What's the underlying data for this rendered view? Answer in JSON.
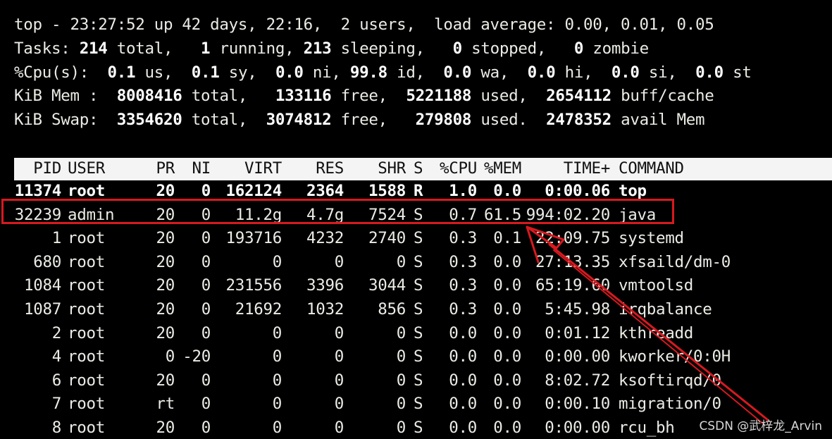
{
  "summary": {
    "line1": "top - 23:27:52 up 42 days, 22:16,  2 users,  load average: 0.00, 0.01, 0.05",
    "tasks": {
      "label": "Tasks:",
      "total": "214",
      "t_total": " total,   ",
      "running": "1",
      "t_running": " running, ",
      "sleeping": "213",
      "t_sleeping": " sleeping,   ",
      "stopped": "0",
      "t_stopped": " stopped,   ",
      "zombie": "0",
      "t_zombie": " zombie"
    },
    "cpu": {
      "label": "%Cpu(s):  ",
      "us": "0.1",
      "t_us": " us,  ",
      "sy": "0.1",
      "t_sy": " sy,  ",
      "ni": "0.0",
      "t_ni": " ni, ",
      "id": "99.8",
      "t_id": " id,  ",
      "wa": "0.0",
      "t_wa": " wa,  ",
      "hi": "0.0",
      "t_hi": " hi,  ",
      "si": "0.0",
      "t_si": " si,  ",
      "st": "0.0",
      "t_st": " st"
    },
    "mem": {
      "label": "KiB Mem :  ",
      "total": "8008416",
      "t_total": " total,   ",
      "free": "133116",
      "t_free": " free,  ",
      "used": "5221188",
      "t_used": " used,  ",
      "buff": "2654112",
      "t_buff": " buff/cache"
    },
    "swap": {
      "label": "KiB Swap:  ",
      "total": "3354620",
      "t_total": " total,  ",
      "free": "3074812",
      "t_free": " free,   ",
      "used": "279808",
      "t_used": " used.  ",
      "avail": "2478352",
      "t_avail": " avail Mem"
    }
  },
  "columns": [
    "PID",
    "USER",
    "PR",
    "NI",
    "VIRT",
    "RES",
    "SHR",
    "S",
    "%CPU",
    "%MEM",
    "TIME+",
    "COMMAND"
  ],
  "processes": [
    [
      "11374",
      "root",
      "20",
      "0",
      "162124",
      "2364",
      "1588",
      "R",
      "1.0",
      "0.0",
      "0:00.06",
      "top"
    ],
    [
      "32239",
      "admin",
      "20",
      "0",
      "11.2g",
      "4.7g",
      "7524",
      "S",
      "0.7",
      "61.5",
      "994:02.20",
      "java"
    ],
    [
      "1",
      "root",
      "20",
      "0",
      "193716",
      "4232",
      "2740",
      "S",
      "0.3",
      "0.1",
      "22:09.75",
      "systemd"
    ],
    [
      "680",
      "root",
      "20",
      "0",
      "0",
      "0",
      "0",
      "S",
      "0.3",
      "0.0",
      "27:13.35",
      "xfsaild/dm-0"
    ],
    [
      "1084",
      "root",
      "20",
      "0",
      "231556",
      "3396",
      "3044",
      "S",
      "0.3",
      "0.0",
      "65:19.60",
      "vmtoolsd"
    ],
    [
      "1087",
      "root",
      "20",
      "0",
      "21692",
      "1032",
      "856",
      "S",
      "0.3",
      "0.0",
      "5:45.98",
      "irqbalance"
    ],
    [
      "2",
      "root",
      "20",
      "0",
      "0",
      "0",
      "0",
      "S",
      "0.0",
      "0.0",
      "0:01.12",
      "kthreadd"
    ],
    [
      "4",
      "root",
      "0",
      "-20",
      "0",
      "0",
      "0",
      "S",
      "0.0",
      "0.0",
      "0:00.00",
      "kworker/0:0H"
    ],
    [
      "6",
      "root",
      "20",
      "0",
      "0",
      "0",
      "0",
      "S",
      "0.0",
      "0.0",
      "8:02.72",
      "ksoftirqd/0"
    ],
    [
      "7",
      "root",
      "rt",
      "0",
      "0",
      "0",
      "0",
      "S",
      "0.0",
      "0.0",
      "0:00.10",
      "migration/0"
    ],
    [
      "8",
      "root",
      "20",
      "0",
      "0",
      "0",
      "0",
      "S",
      "0.0",
      "0.0",
      "0:00.00",
      "rcu_bh"
    ]
  ],
  "annotation": {
    "highlight_color": "#d8191f"
  },
  "watermark": "CSDN @武梓龙_Arvin"
}
